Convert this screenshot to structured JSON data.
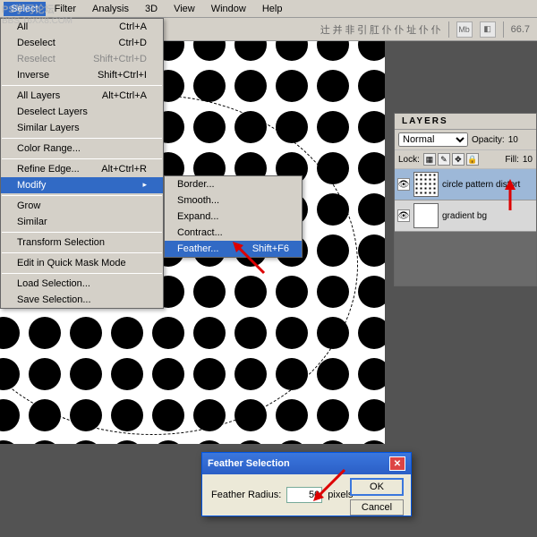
{
  "watermark": {
    "line1": "PS学习论坛",
    "line2": "BBS.16XX8.COM"
  },
  "menubar": {
    "items": [
      "Select",
      "Filter",
      "Analysis",
      "3D",
      "View",
      "Window",
      "Help"
    ],
    "active_index": 0
  },
  "toolbar": {
    "zoom": "66.7"
  },
  "select_menu": {
    "items": [
      {
        "label": "All",
        "shortcut": "Ctrl+A"
      },
      {
        "label": "Deselect",
        "shortcut": "Ctrl+D"
      },
      {
        "label": "Reselect",
        "shortcut": "Shift+Ctrl+D",
        "disabled": true
      },
      {
        "label": "Inverse",
        "shortcut": "Shift+Ctrl+I"
      },
      {
        "sep": true
      },
      {
        "label": "All Layers",
        "shortcut": "Alt+Ctrl+A"
      },
      {
        "label": "Deselect Layers",
        "shortcut": ""
      },
      {
        "label": "Similar Layers",
        "shortcut": ""
      },
      {
        "sep": true
      },
      {
        "label": "Color Range...",
        "shortcut": ""
      },
      {
        "sep": true
      },
      {
        "label": "Refine Edge...",
        "shortcut": "Alt+Ctrl+R"
      },
      {
        "label": "Modify",
        "shortcut": "",
        "arrow": true,
        "hl": true
      },
      {
        "sep": true
      },
      {
        "label": "Grow",
        "shortcut": ""
      },
      {
        "label": "Similar",
        "shortcut": ""
      },
      {
        "sep": true
      },
      {
        "label": "Transform Selection",
        "shortcut": ""
      },
      {
        "sep": true
      },
      {
        "label": "Edit in Quick Mask Mode",
        "shortcut": ""
      },
      {
        "sep": true
      },
      {
        "label": "Load Selection...",
        "shortcut": ""
      },
      {
        "label": "Save Selection...",
        "shortcut": ""
      }
    ]
  },
  "modify_submenu": {
    "items": [
      {
        "label": "Border...",
        "shortcut": ""
      },
      {
        "label": "Smooth...",
        "shortcut": ""
      },
      {
        "label": "Expand...",
        "shortcut": ""
      },
      {
        "label": "Contract...",
        "shortcut": ""
      },
      {
        "label": "Feather...",
        "shortcut": "Shift+F6",
        "hl": true
      }
    ]
  },
  "layers_panel": {
    "title": "LAYERS",
    "blend_mode": "Normal",
    "opacity_label": "Opacity:",
    "opacity_value": "10",
    "lock_label": "Lock:",
    "fill_label": "Fill:",
    "fill_value": "10",
    "layers": [
      {
        "name": "circle pattern distort",
        "selected": true,
        "thumb": "dots"
      },
      {
        "name": "gradient bg",
        "selected": false,
        "thumb": "white"
      }
    ]
  },
  "dialog": {
    "title": "Feather Selection",
    "label": "Feather Radius:",
    "value": "50",
    "unit": "pixels",
    "ok": "OK",
    "cancel": "Cancel"
  }
}
